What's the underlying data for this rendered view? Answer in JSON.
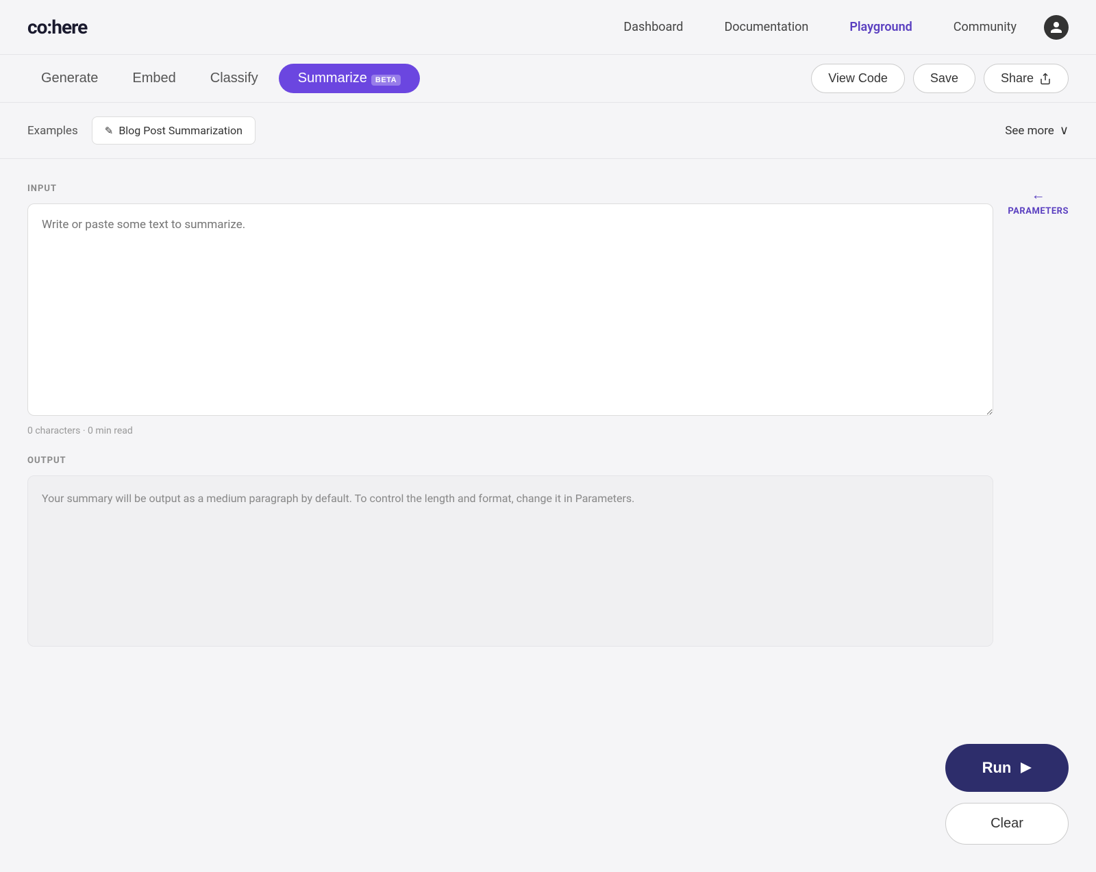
{
  "logo": {
    "text": "co:here"
  },
  "navbar": {
    "links": [
      {
        "label": "Dashboard",
        "active": false
      },
      {
        "label": "Documentation",
        "active": false
      },
      {
        "label": "Playground",
        "active": true
      },
      {
        "label": "Community",
        "active": false
      }
    ]
  },
  "tabs": {
    "items": [
      {
        "label": "Generate",
        "active": false
      },
      {
        "label": "Embed",
        "active": false
      },
      {
        "label": "Classify",
        "active": false
      },
      {
        "label": "Summarize",
        "active": true,
        "beta": true
      }
    ],
    "actions": [
      {
        "label": "View Code"
      },
      {
        "label": "Save"
      },
      {
        "label": "Share"
      }
    ]
  },
  "examples": {
    "label": "Examples",
    "items": [
      {
        "label": "Blog Post Summarization"
      }
    ],
    "see_more": "See more"
  },
  "input": {
    "label": "INPUT",
    "placeholder": "Write or paste some text to summarize.",
    "char_count": "0 characters · 0 min read"
  },
  "parameters": {
    "arrow": "←",
    "label": "PARAMETERS"
  },
  "output": {
    "label": "OUTPUT",
    "placeholder_text": "Your summary will be output as a medium paragraph by default. To control the length and format, change it in Parameters."
  },
  "actions": {
    "run_label": "Run",
    "clear_label": "Clear"
  }
}
